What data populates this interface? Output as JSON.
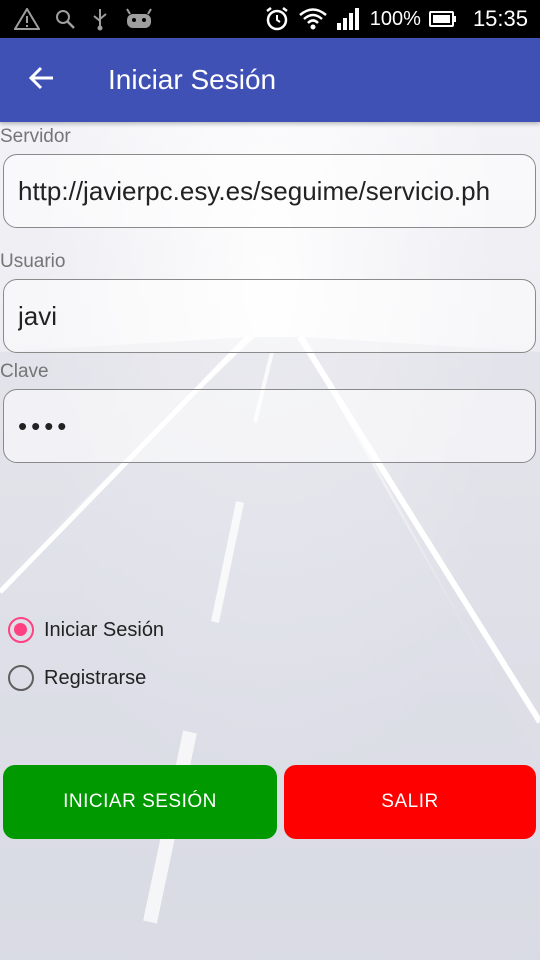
{
  "status_bar": {
    "battery": "100%",
    "time": "15:35",
    "icons": [
      "warning-icon",
      "search-icon",
      "usb-icon",
      "android-icon",
      "alarm-icon",
      "wifi-icon",
      "signal-icon",
      "battery-icon"
    ]
  },
  "app_bar": {
    "title": "Iniciar Sesión",
    "back_icon": "arrow-back-icon",
    "color": "#3f51b5"
  },
  "form": {
    "server_label": "Servidor",
    "server_value": "http://javierpc.esy.es/seguime/servicio.ph",
    "user_label": "Usuario",
    "user_value": "javi",
    "password_label": "Clave",
    "password_value": "••••"
  },
  "mode": {
    "options": [
      {
        "label": "Iniciar Sesión",
        "selected": true
      },
      {
        "label": "Registrarse",
        "selected": false
      }
    ],
    "accent": "#ff4081"
  },
  "buttons": {
    "login_label": "INICIAR SESIÓN",
    "login_color": "#009900",
    "exit_label": "SALIR",
    "exit_color": "#ff0000"
  }
}
